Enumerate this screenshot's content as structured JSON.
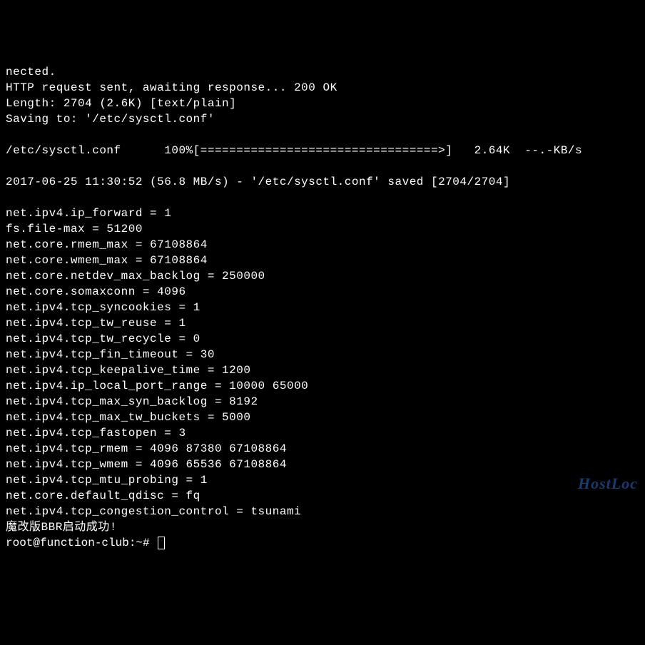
{
  "lines": [
    "nected.",
    "HTTP request sent, awaiting response... 200 OK",
    "Length: 2704 (2.6K) [text/plain]",
    "Saving to: '/etc/sysctl.conf'",
    "",
    "/etc/sysctl.conf      100%[=================================>]   2.64K  --.-KB/s",
    "",
    "2017-06-25 11:30:52 (56.8 MB/s) - '/etc/sysctl.conf' saved [2704/2704]",
    "",
    "net.ipv4.ip_forward = 1",
    "fs.file-max = 51200",
    "net.core.rmem_max = 67108864",
    "net.core.wmem_max = 67108864",
    "net.core.netdev_max_backlog = 250000",
    "net.core.somaxconn = 4096",
    "net.ipv4.tcp_syncookies = 1",
    "net.ipv4.tcp_tw_reuse = 1",
    "net.ipv4.tcp_tw_recycle = 0",
    "net.ipv4.tcp_fin_timeout = 30",
    "net.ipv4.tcp_keepalive_time = 1200",
    "net.ipv4.ip_local_port_range = 10000 65000",
    "net.ipv4.tcp_max_syn_backlog = 8192",
    "net.ipv4.tcp_max_tw_buckets = 5000",
    "net.ipv4.tcp_fastopen = 3",
    "net.ipv4.tcp_rmem = 4096 87380 67108864",
    "net.ipv4.tcp_wmem = 4096 65536 67108864",
    "net.ipv4.tcp_mtu_probing = 1",
    "net.core.default_qdisc = fq",
    "net.ipv4.tcp_congestion_control = tsunami",
    "魔改版BBR启动成功!"
  ],
  "prompt": "root@function-club:~# ",
  "watermark": "HostLoc"
}
